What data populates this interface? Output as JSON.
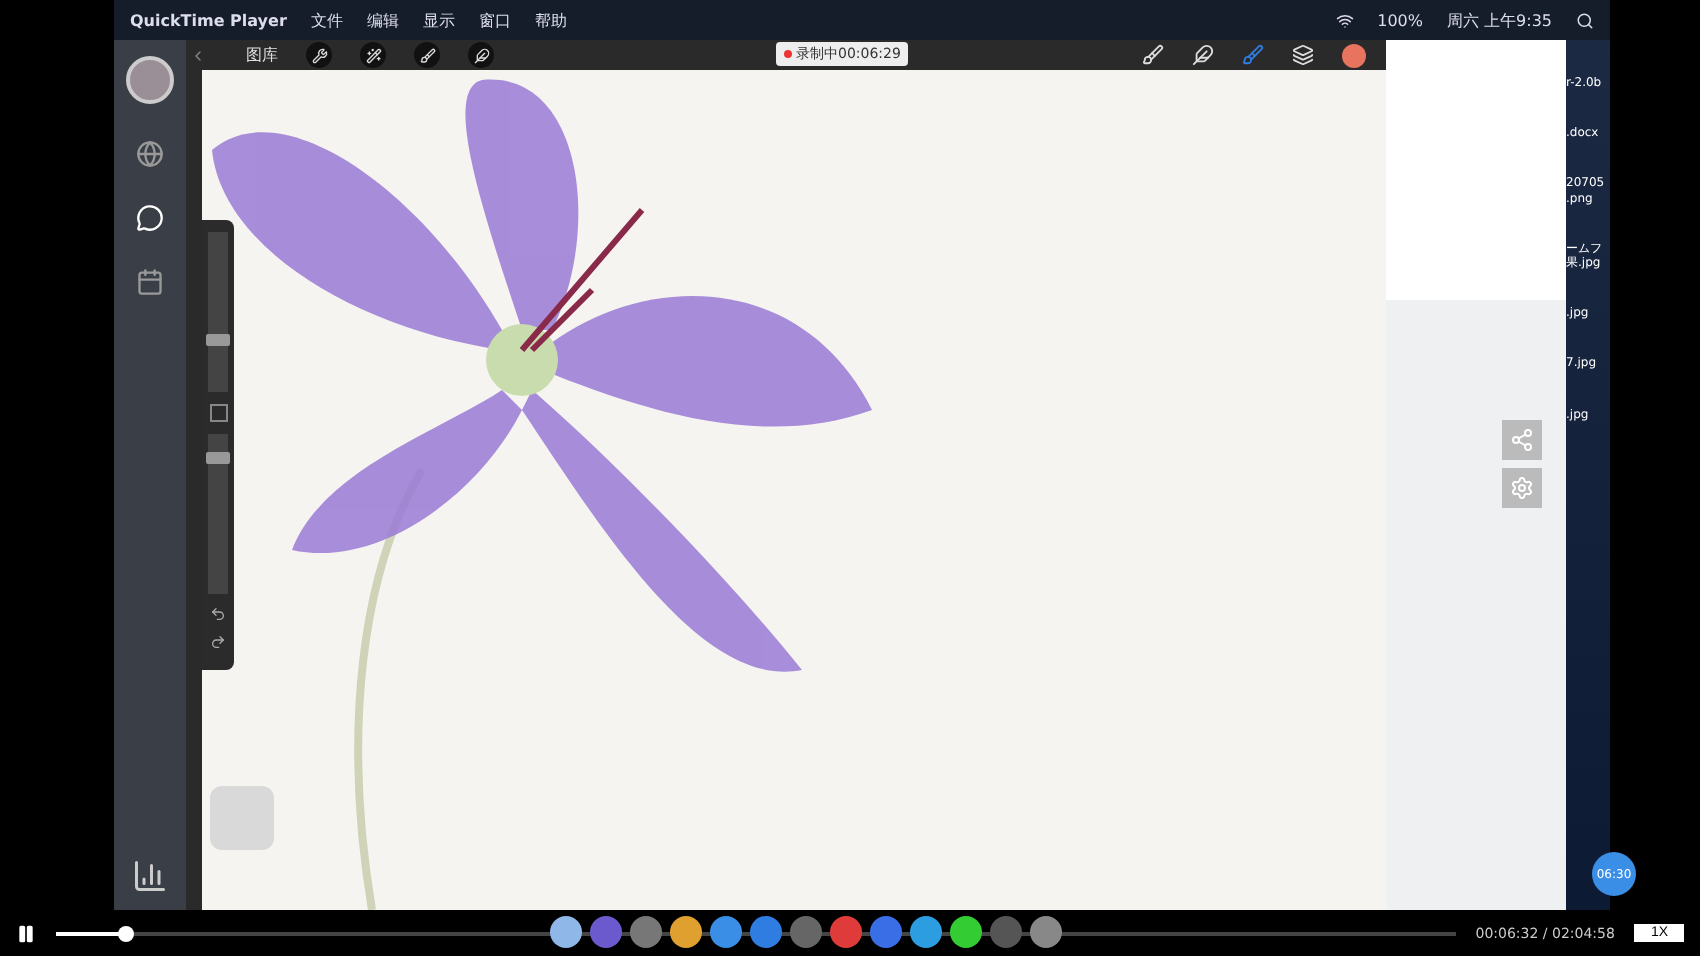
{
  "menu_bar": {
    "app": "QuickTime Player",
    "menus": [
      "文件",
      "编辑",
      "显示",
      "窗口",
      "帮助"
    ],
    "battery": "100%",
    "clock": "周六 上午9:35"
  },
  "procreate": {
    "gallery": "图库",
    "recording": "录制中00:06:29",
    "brush_size": {
      "level": 0.33
    },
    "opacity": {
      "level": 0.85
    },
    "color": "#e8735f"
  },
  "desktop_files": [
    "r-2.0b",
    ".docx",
    "20705 .png",
    "ームフ果.jpg",
    ".jpg",
    "7.jpg",
    ".jpg"
  ],
  "player": {
    "level": 0.05,
    "time": "00:06:32 / 02:04:58",
    "speed": "1X",
    "badge": "06:30"
  }
}
